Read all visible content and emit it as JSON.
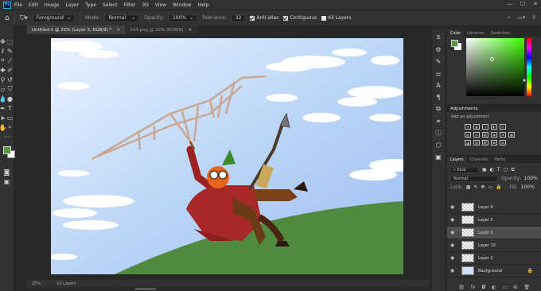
{
  "menu": [
    "File",
    "Edit",
    "Image",
    "Layer",
    "Type",
    "Select",
    "Filter",
    "3D",
    "View",
    "Window",
    "Help"
  ],
  "logo": "Ps",
  "options": {
    "fill_source": "Foreground",
    "mode_label": "Mode:",
    "mode_value": "Normal",
    "opacity_label": "Opacity:",
    "opacity_value": "100%",
    "tolerance_label": "Tolerance:",
    "tolerance_value": "32",
    "antialias_label": "Anti-alias",
    "contiguous_label": "Contiguous",
    "all_layers_label": "All Layers"
  },
  "tabs": [
    {
      "label": "Untitled-1 @ 25% (Layer 3, RGB/8) *",
      "active": true
    },
    {
      "label": "143.png @ 25% (RGB/8)",
      "active": false
    }
  ],
  "status": {
    "zoom": "25%",
    "info": "10 Layers"
  },
  "colors": {
    "foreground": "#5a9445",
    "background": "#ffffff",
    "accent": "#31a8ff"
  },
  "color_panel": {
    "tabs": [
      "Color",
      "Libraries",
      "Swatches"
    ]
  },
  "adjustments": {
    "title": "Adjustments",
    "subtitle": "Add an adjustment"
  },
  "layers_panel": {
    "tabs": [
      "Layers",
      "Channels",
      "Paths"
    ],
    "kind": "Kind",
    "blend": "Normal",
    "opacity_label": "Opacity:",
    "opacity_value": "100%",
    "lock_label": "Lock:",
    "fill_label": "Fill:",
    "fill_value": "100%",
    "layers": [
      {
        "name": "Layer 9",
        "selected": false,
        "type": "transparent"
      },
      {
        "name": "Layer 5",
        "selected": false,
        "type": "transparent"
      },
      {
        "name": "Layer 3",
        "selected": true,
        "type": "transparent"
      },
      {
        "name": "Layer 10",
        "selected": false,
        "type": "transparent"
      },
      {
        "name": "Layer 2",
        "selected": false,
        "type": "transparent"
      },
      {
        "name": "Background",
        "selected": false,
        "type": "background"
      }
    ]
  }
}
